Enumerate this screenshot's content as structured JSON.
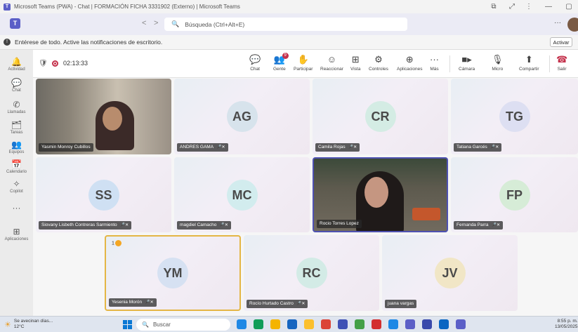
{
  "window": {
    "title": "Microsoft Teams (PWA) - Chat | FORMACIÓN FICHA 3331902 (Externo) | Microsoft Teams",
    "controls": [
      "⧉",
      "⤢",
      "⋮",
      "—",
      "▢"
    ]
  },
  "header": {
    "search_text": "Búsqueda (Ctrl+Alt+E)",
    "back_arrow": "<",
    "forward_arrow": ">",
    "more": "···"
  },
  "notification": {
    "text": "Entérese de todo. Active las notificaciones de escritorio.",
    "button": "Activar"
  },
  "rail": [
    {
      "label": "Actividad",
      "icon": "bell-icon",
      "glyph": "🔔"
    },
    {
      "label": "Chat",
      "icon": "chat-icon",
      "glyph": "💬"
    },
    {
      "label": "Llamadas",
      "icon": "phone-icon",
      "glyph": "✆"
    },
    {
      "label": "Tareas",
      "icon": "tasks-icon",
      "glyph": "🗂"
    },
    {
      "label": "Equipos",
      "icon": "teams-icon",
      "glyph": "👥"
    },
    {
      "label": "Calendario",
      "icon": "calendar-icon",
      "glyph": "📅"
    },
    {
      "label": "Copilot",
      "icon": "copilot-icon",
      "glyph": "✧"
    },
    {
      "label": "",
      "icon": "more-icon",
      "glyph": "···"
    },
    {
      "label": "Aplicaciones",
      "icon": "apps-icon",
      "glyph": "⊞"
    }
  ],
  "meeting": {
    "timer": "02:13:33",
    "toolbar": [
      {
        "label": "Chat",
        "glyph": "💬",
        "name": "chat-button"
      },
      {
        "label": "Gente",
        "glyph": "👥",
        "name": "people-button",
        "badge": "9"
      },
      {
        "label": "Participar",
        "glyph": "✋",
        "name": "raise-hand-button"
      },
      {
        "label": "Reaccionar",
        "glyph": "☺",
        "name": "react-button"
      },
      {
        "label": "Vista",
        "glyph": "⊞",
        "name": "view-button"
      },
      {
        "label": "Controles",
        "glyph": "⚙",
        "name": "controls-button"
      },
      {
        "label": "Aplicaciones",
        "glyph": "⊕",
        "name": "apps-button"
      },
      {
        "label": "Más",
        "glyph": "···",
        "name": "more-button"
      }
    ],
    "media": [
      {
        "label": "Cámara",
        "glyph": "■▸",
        "name": "camera-button"
      },
      {
        "label": "Micro",
        "glyph": "🎙",
        "name": "mic-button"
      },
      {
        "label": "Compartir",
        "glyph": "⬆",
        "name": "share-button"
      },
      {
        "label": "Salir",
        "glyph": "☎",
        "name": "leave-button"
      }
    ]
  },
  "participants": [
    {
      "name": "Yasmin Monroy Cubillos",
      "initials": "",
      "video": true,
      "mic": false
    },
    {
      "name": "ANDRES GAMA",
      "initials": "AG",
      "color": "#bf5f00",
      "bg": "#d7e3ec",
      "mic": true
    },
    {
      "name": "Camila Rojas",
      "initials": "CR",
      "color": "#0f7b58",
      "bg": "#d4ece4",
      "mic": true
    },
    {
      "name": "Tatiana Garcés",
      "initials": "TG",
      "color": "#555bb0",
      "bg": "#dddff2",
      "mic": true
    },
    {
      "name": "Siovany Lisbeth Contreras Sarmiento",
      "initials": "SS",
      "color": "#005a9e",
      "bg": "#cfe0f3",
      "mic": true
    },
    {
      "name": "magdiel Camacho",
      "initials": "MC",
      "color": "#1d7a86",
      "bg": "#d2ecee",
      "mic": true
    },
    {
      "name": "Rocio Torres Lopez",
      "initials": "",
      "video": true,
      "mic": false
    },
    {
      "name": "Fernanda Parra",
      "initials": "FP",
      "color": "#2c7a3a",
      "bg": "#d6ecd7",
      "mic": true
    },
    {
      "name": "Yesenia Morón",
      "initials": "YM",
      "color": "#2a5a9e",
      "bg": "#d6e1f2",
      "mic": true,
      "reaction": "1"
    },
    {
      "name": "Rocío Hurtado Castro",
      "initials": "RC",
      "color": "#1d7a6e",
      "bg": "#d3ebe6",
      "mic": true
    },
    {
      "name": "juana vargas",
      "initials": "JV",
      "color": "#8a6a00",
      "bg": "#f1e6c6",
      "mic": false
    }
  ],
  "taskbar": {
    "weather_line1": "Se avecinan días...",
    "weather_line2": "12°C",
    "search": "Buscar",
    "time": "8:55 p. m.",
    "date": "13/05/2025",
    "apps": [
      "#1e88e5",
      "#0f9d58",
      "#f4b400",
      "#1565c0",
      "#fbc02d",
      "#db4437",
      "#3f51b5",
      "#43a047",
      "#d32f2f",
      "#1e88e5",
      "#5b5fc7",
      "#3949ab",
      "#0a66c2",
      "#5b5fc7"
    ]
  },
  "icons": {
    "shield": "🛡",
    "mic_off": "🎤",
    "hand": "✋",
    "search": "🔍",
    "info": "!",
    "weather": "☀"
  }
}
